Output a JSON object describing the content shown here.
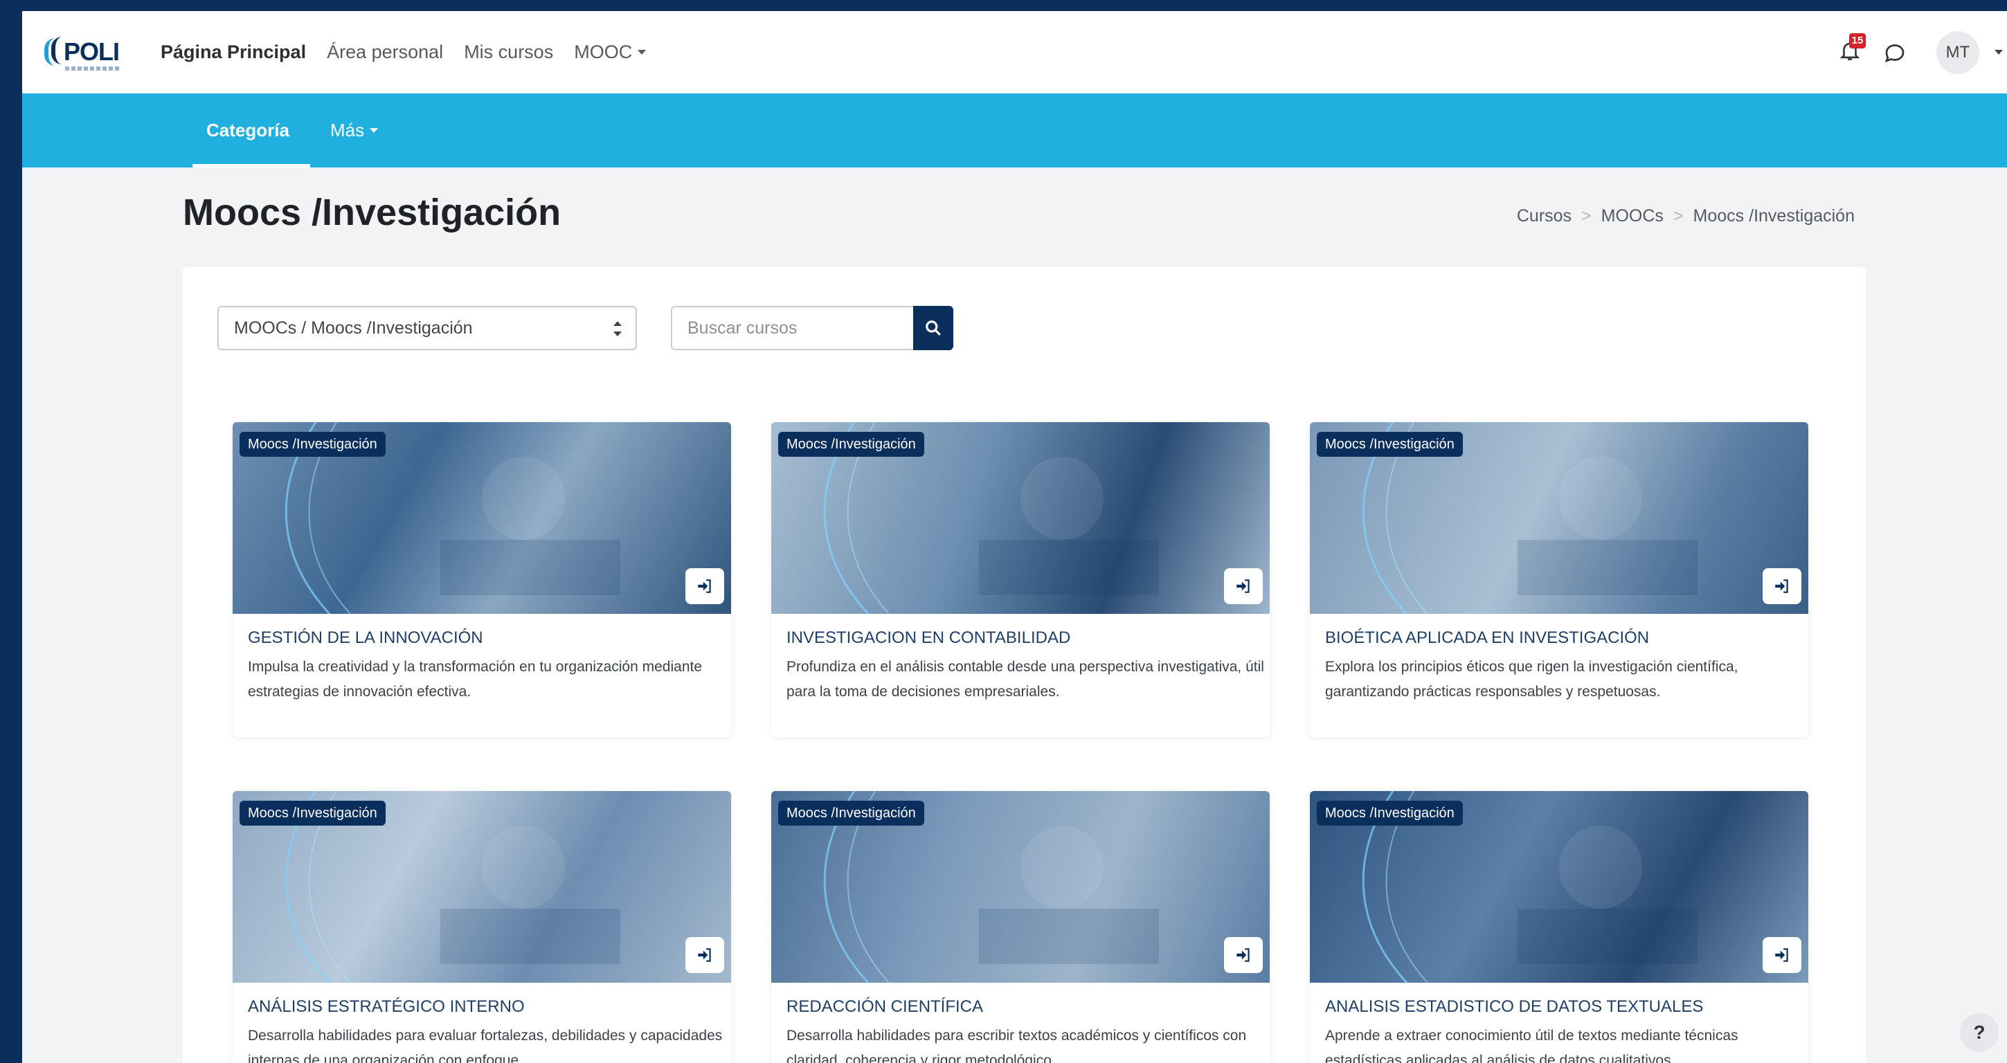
{
  "topbar": {
    "logo_text": "POLI",
    "nav": [
      {
        "label": "Página Principal",
        "active": true
      },
      {
        "label": "Área personal"
      },
      {
        "label": "Mis cursos"
      },
      {
        "label": "MOOC",
        "dropdown": true
      }
    ],
    "notifications_count": "15",
    "avatar_initials": "MT"
  },
  "subnav": {
    "tabs": [
      {
        "label": "Categoría",
        "active": true
      },
      {
        "label": "Más",
        "dropdown": true
      }
    ]
  },
  "page": {
    "title": "Moocs /Investigación",
    "breadcrumb": [
      "Cursos",
      "MOOCs",
      "Moocs /Investigación"
    ],
    "breadcrumb_separator": ">"
  },
  "filters": {
    "category_selected": "MOOCs / Moocs /Investigación",
    "search_placeholder": "Buscar cursos"
  },
  "courses": [
    {
      "tag": "Moocs /Investigación",
      "title": "GESTIÓN DE LA INNOVACIÓN",
      "description": "Impulsa la creatividad y la transformación en tu organización mediante estrategias de innovación efectiva."
    },
    {
      "tag": "Moocs /Investigación",
      "title": "INVESTIGACION EN CONTABILIDAD",
      "description": "Profundiza en el análisis contable desde una perspectiva investigativa, útil para la toma de decisiones empresariales."
    },
    {
      "tag": "Moocs /Investigación",
      "title": "BIOÉTICA APLICADA EN INVESTIGACIÓN",
      "description": "Explora los principios éticos que rigen la investigación científica, garantizando prácticas responsables y respetuosas."
    },
    {
      "tag": "Moocs /Investigación",
      "title": "ANÁLISIS ESTRATÉGICO INTERNO",
      "description": "Desarrolla habilidades para evaluar fortalezas, debilidades y capacidades internas de una organización con enfoque"
    },
    {
      "tag": "Moocs /Investigación",
      "title": "REDACCIÓN CIENTÍFICA",
      "description": "Desarrolla habilidades para escribir textos académicos y científicos con claridad, coherencia y rigor metodológico."
    },
    {
      "tag": "Moocs /Investigación",
      "title": "ANALISIS ESTADISTICO DE DATOS TEXTUALES",
      "description": "Aprende a extraer conocimiento útil de textos mediante técnicas estadísticas aplicadas al análisis de datos cualitativos."
    }
  ],
  "help_label": "?",
  "colors": {
    "brand_dark": "#0a2f5c",
    "brand_light": "#1fb0df",
    "alert": "#d0232b"
  }
}
